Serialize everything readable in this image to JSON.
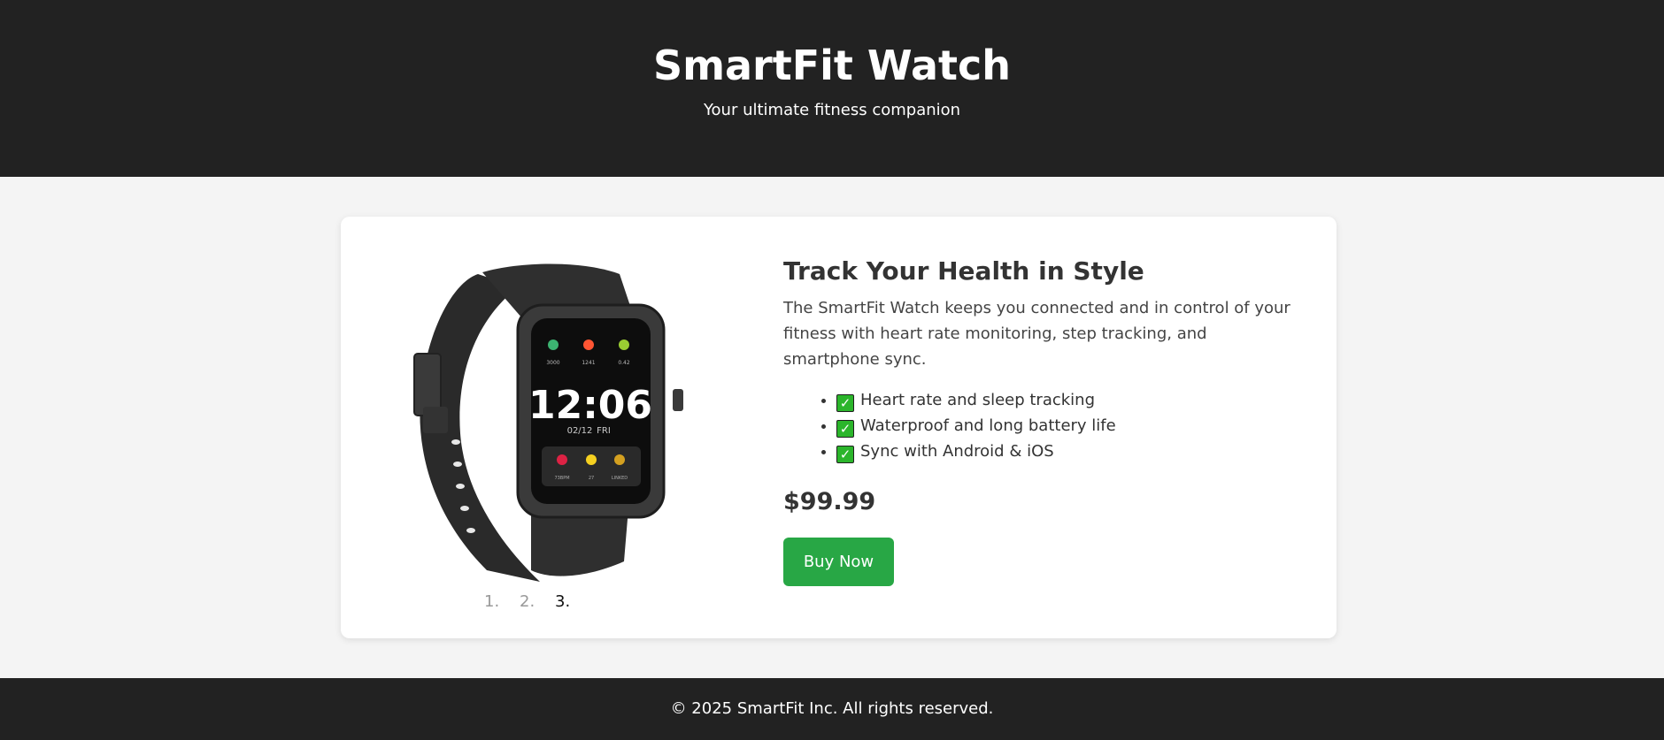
{
  "header": {
    "title": "SmartFit Watch",
    "subtitle": "Your ultimate fitness companion"
  },
  "product": {
    "image": {
      "icon": "smartwatch-image",
      "screen": {
        "time": "12:06",
        "date": "02/12",
        "day": "FRI",
        "top_stats": [
          "3000",
          "1241",
          "0.42"
        ],
        "bottom_stats": [
          "73BPM",
          "27",
          "LINKED"
        ]
      }
    },
    "pager": [
      "1.",
      "2.",
      "3."
    ],
    "pager_active_index": 2,
    "headline": "Track Your Health in Style",
    "description": "The SmartFit Watch keeps you connected and in control of your fitness with heart rate monitoring, step tracking, and smartphone sync.",
    "features": [
      {
        "icon": "check-mark-icon",
        "label": "Heart rate and sleep tracking"
      },
      {
        "icon": "check-mark-icon",
        "label": "Waterproof and long battery life"
      },
      {
        "icon": "check-mark-icon",
        "label": "Sync with Android & iOS"
      }
    ],
    "price": "$99.99",
    "buy_label": "Buy Now"
  },
  "footer": {
    "text": "© 2025 SmartFit Inc. All rights reserved."
  },
  "colors": {
    "header_bg": "#222222",
    "page_bg": "#f4f4f4",
    "card_bg": "#ffffff",
    "accent": "#28a745",
    "check_bg": "#2bb52b"
  }
}
